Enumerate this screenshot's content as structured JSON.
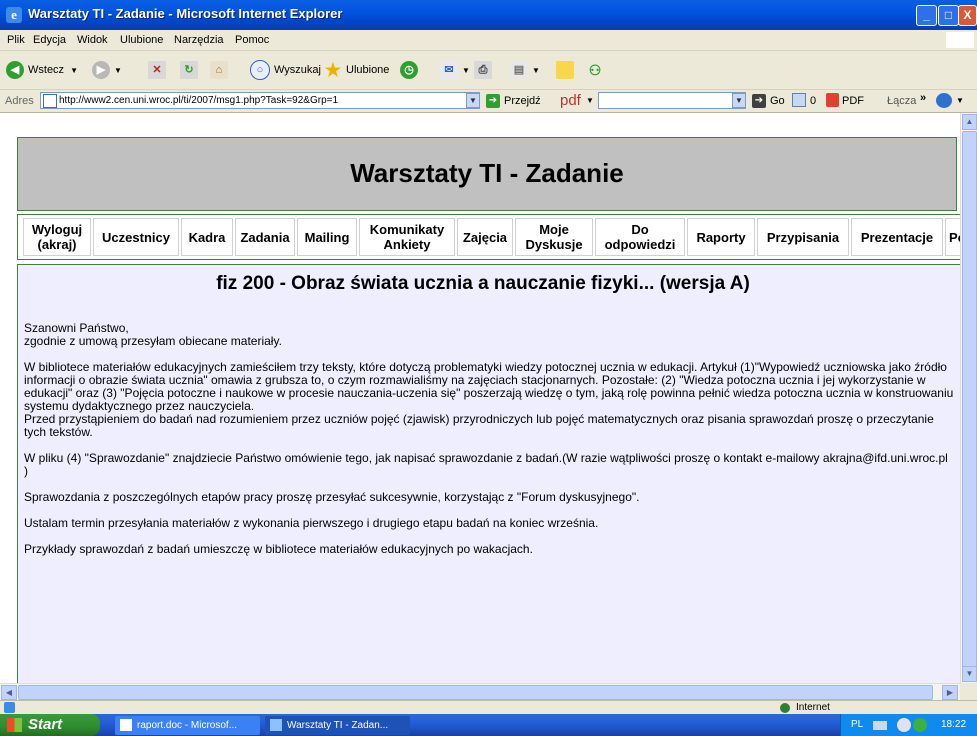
{
  "window": {
    "title": "Warsztaty TI - Zadanie - Microsoft Internet Explorer",
    "minimize": "_",
    "maximize": "□",
    "close": "X"
  },
  "menu": [
    "Plik",
    "Edycja",
    "Widok",
    "Ulubione",
    "Narzędzia",
    "Pomoc"
  ],
  "toolbar": {
    "back": "Wstecz",
    "search": "Wyszukaj",
    "favorites": "Ulubione"
  },
  "address": {
    "label": "Adres",
    "url": "http://www2.cen.uni.wroc.pl/ti/2007/msg1.php?Task=92&Grp=1",
    "go": "Przejdź",
    "pdf_label": "pdf",
    "go2": "Go",
    "count": "0",
    "pdf2": "PDF",
    "links": "Łącza"
  },
  "page": {
    "header_title": "Warsztaty TI - Zadanie",
    "nav": [
      {
        "label": "Wyloguj (akraj)"
      },
      {
        "label": "Uczestnicy"
      },
      {
        "label": "Kadra"
      },
      {
        "label": "Zadania"
      },
      {
        "label": "Mailing"
      },
      {
        "label": "Komunikaty Ankiety"
      },
      {
        "label": "Zajęcia"
      },
      {
        "label": "Moje Dyskusje"
      },
      {
        "label": "Do odpowiedzi"
      },
      {
        "label": "Raporty"
      },
      {
        "label": "Przypisania"
      },
      {
        "label": "Prezentacje"
      },
      {
        "label": "Po"
      }
    ],
    "task_title": "fiz 200 - Obraz świata ucznia a nauczanie fizyki... (wersja A)",
    "paragraphs": [
      "Szanowni Państwo,",
      "zgodnie z umową przesyłam obiecane materiały.",
      "W bibliotece materiałów edukacyjnych zamieściłem trzy teksty, które dotyczą problematyki wiedzy potocznej ucznia w edukacji. Artykuł (1)\"Wypowiedź uczniowska jako źródło informacji o obrazie świata ucznia\" omawia z grubsza to, o czym rozmawialiśmy na zajęciach stacjonarnych. Pozostałe: (2) \"Wiedza potoczna ucznia i jej wykorzystanie w edukacji\" oraz (3) \"Pojęcia potoczne i naukowe w procesie nauczania-uczenia się\" poszerzają wiedzę o tym, jaką rolę powinna pełnić wiedza potoczna ucznia w konstruowaniu systemu dydaktycznego przez nauczyciela.",
      "Przed przystąpieniem do badań nad rozumieniem przez uczniów pojęć (zjawisk) przyrodniczych lub pojęć matematycznych oraz pisania sprawozdań proszę o przeczytanie tych tekstów.",
      "W pliku (4) \"Sprawozdanie\" znajdziecie Państwo omówienie tego, jak napisać sprawozdanie z badań.(W razie wątpliwości proszę o kontakt e-mailowy akrajna@ifd.uni.wroc.pl )",
      "Sprawozdania z poszczególnych etapów pracy proszę przesyłać sukcesywnie, korzystając z \"Forum dyskusyjnego\".",
      "Ustalam termin przesyłania materiałów z wykonania pierwszego i drugiego etapu badań na koniec września.",
      "Przykłady sprawozdań z badań umieszczę w bibliotece materiałów edukacyjnych po wakacjach."
    ]
  },
  "status": {
    "zone": "Internet"
  },
  "taskbar": {
    "start": "Start",
    "tasks": [
      "raport.doc - Microsof...",
      "Warsztaty TI - Zadan..."
    ],
    "lang": "PL",
    "time": "18:22"
  },
  "colors": {
    "header_bg": "#C0C0C0",
    "content_bg": "#EEEEFE",
    "border": "#3F7F3F"
  }
}
